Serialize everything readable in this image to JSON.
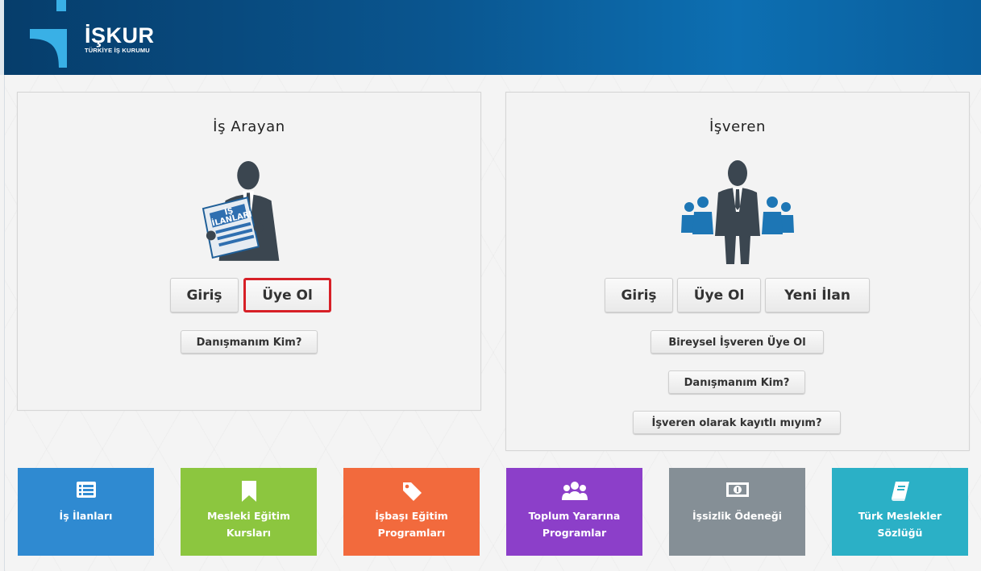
{
  "header": {
    "logo_title": "İŞKUR",
    "logo_subtitle": "TÜRKİYE İŞ KURUMU",
    "brand_color": "#0a5690"
  },
  "job_seeker": {
    "title": "İş Arayan",
    "newspaper_line1": "İŞ",
    "newspaper_line2": "İLANLARI",
    "login_label": "Giriş",
    "register_label": "Üye Ol",
    "advisor_label": "Danışmanım Kim?"
  },
  "employer": {
    "title": "İşveren",
    "login_label": "Giriş",
    "register_label": "Üye Ol",
    "new_listing_label": "Yeni İlan",
    "individual_register_label": "Bireysel İşveren Üye Ol",
    "advisor_label": "Danışmanım Kim?",
    "registered_check_label": "İşveren olarak kayıtlı mıyım?"
  },
  "tiles": [
    {
      "label": "İş İlanları",
      "color": "#2f8ad1",
      "icon": "list-icon"
    },
    {
      "label": "Mesleki Eğitim Kursları",
      "color": "#8cc63f",
      "icon": "bookmark-icon"
    },
    {
      "label": "İşbaşı Eğitim Programları",
      "color": "#f26a3d",
      "icon": "tag-icon"
    },
    {
      "label": "Toplum Yararına Programlar",
      "color": "#8c3fc9",
      "icon": "group-icon"
    },
    {
      "label": "İşsizlik Ödeneği",
      "color": "#858f96",
      "icon": "money-icon"
    },
    {
      "label": "Türk Meslekler Sözlüğü",
      "color": "#2bb0c6",
      "icon": "book-icon"
    }
  ]
}
